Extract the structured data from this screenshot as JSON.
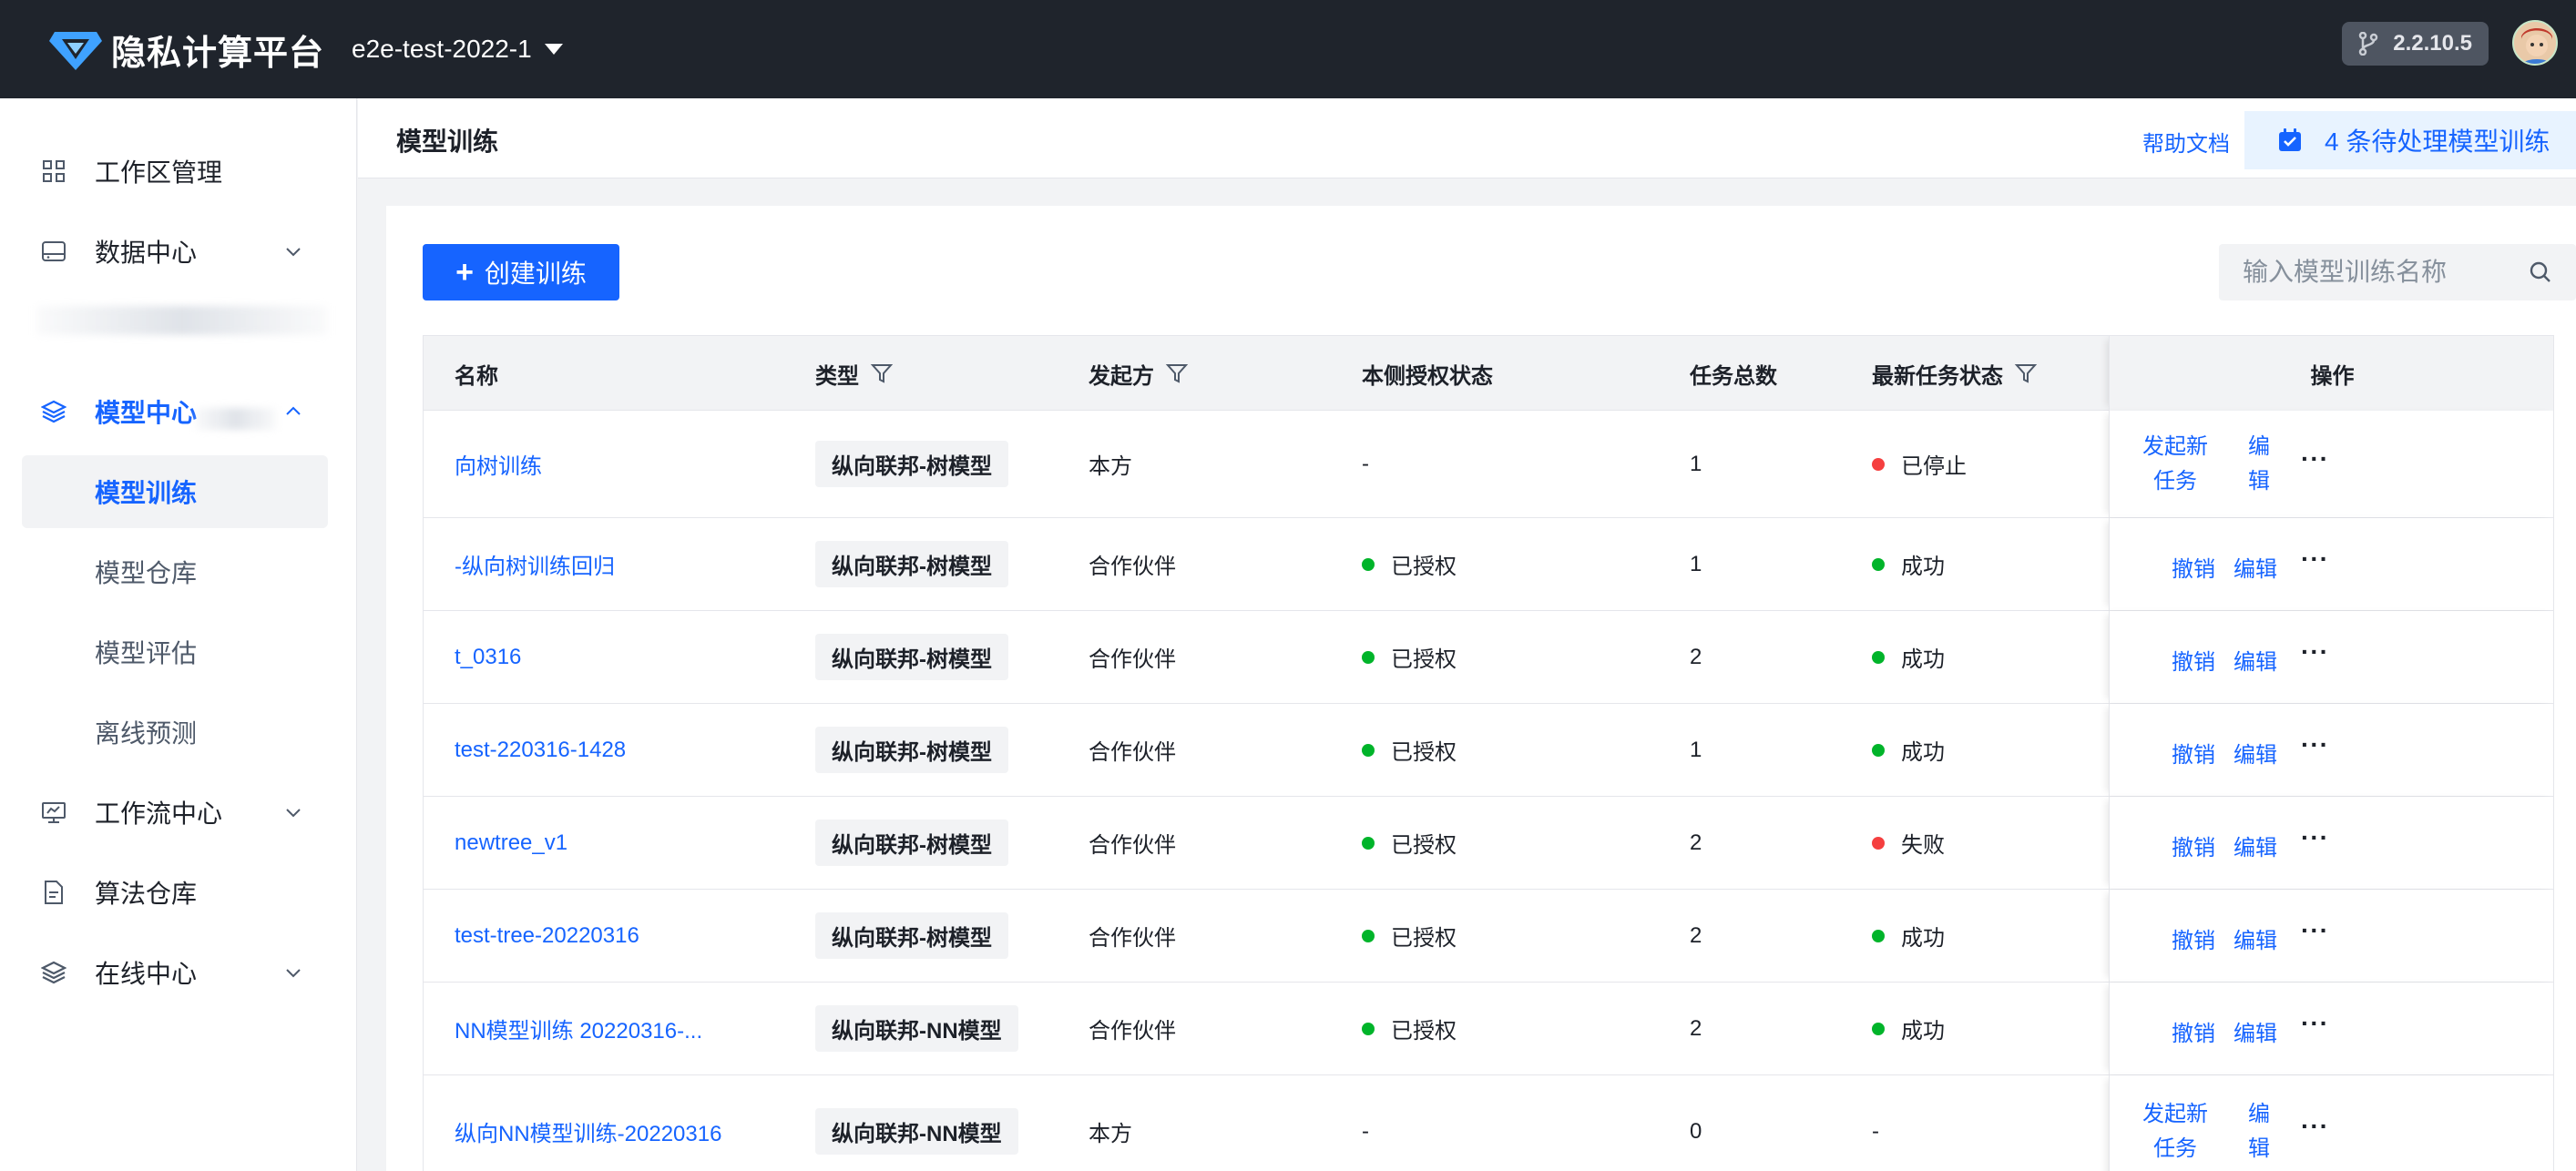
{
  "header": {
    "logo_text": "隐私计算平台",
    "project": "e2e-test-2022-1",
    "version": "2.2.10.5"
  },
  "sidebar": {
    "items": [
      {
        "label": "工作区管理",
        "icon": "grid-icon"
      },
      {
        "label": "数据中心",
        "icon": "hard-drive-icon"
      },
      {
        "label": "模型中心",
        "icon": "layers-icon"
      },
      {
        "label": "工作流中心",
        "icon": "monitor-icon"
      },
      {
        "label": "算法仓库",
        "icon": "file-icon"
      },
      {
        "label": "在线中心",
        "icon": "layers-icon"
      }
    ],
    "model_sub": [
      "模型训练",
      "模型仓库",
      "模型评估",
      "离线预测"
    ]
  },
  "page": {
    "title": "模型训练",
    "help": "帮助文档",
    "pending": "4 条待处理模型训练",
    "create_label": "创建训练",
    "search_placeholder": "输入模型训练名称"
  },
  "table": {
    "headers": [
      "名称",
      "类型",
      "发起方",
      "本侧授权状态",
      "任务总数",
      "最新任务状态",
      "操作"
    ],
    "rows": [
      {
        "name": "向树训练",
        "type": "纵向联邦-树模型",
        "initiator": "本方",
        "auth": "-",
        "auth_dot": "",
        "count": "1",
        "status": "已停止",
        "status_dot": "red",
        "ops": [
          "发起新任务",
          "编辑"
        ]
      },
      {
        "name": "-纵向树训练回归",
        "type": "纵向联邦-树模型",
        "initiator": "合作伙伴",
        "auth": "已授权",
        "auth_dot": "green",
        "count": "1",
        "status": "成功",
        "status_dot": "green",
        "ops": [
          "撤销",
          "编辑"
        ]
      },
      {
        "name": "t_0316",
        "type": "纵向联邦-树模型",
        "initiator": "合作伙伴",
        "auth": "已授权",
        "auth_dot": "green",
        "count": "2",
        "status": "成功",
        "status_dot": "green",
        "ops": [
          "撤销",
          "编辑"
        ]
      },
      {
        "name": "test-220316-1428",
        "type": "纵向联邦-树模型",
        "initiator": "合作伙伴",
        "auth": "已授权",
        "auth_dot": "green",
        "count": "1",
        "status": "成功",
        "status_dot": "green",
        "ops": [
          "撤销",
          "编辑"
        ]
      },
      {
        "name": "newtree_v1",
        "type": "纵向联邦-树模型",
        "initiator": "合作伙伴",
        "auth": "已授权",
        "auth_dot": "green",
        "count": "2",
        "status": "失败",
        "status_dot": "red",
        "ops": [
          "撤销",
          "编辑"
        ]
      },
      {
        "name": "test-tree-20220316",
        "type": "纵向联邦-树模型",
        "initiator": "合作伙伴",
        "auth": "已授权",
        "auth_dot": "green",
        "count": "2",
        "status": "成功",
        "status_dot": "green",
        "ops": [
          "撤销",
          "编辑"
        ]
      },
      {
        "name": "NN模型训练 20220316-...",
        "type": "纵向联邦-NN模型",
        "initiator": "合作伙伴",
        "auth": "已授权",
        "auth_dot": "green",
        "count": "2",
        "status": "成功",
        "status_dot": "green",
        "ops": [
          "撤销",
          "编辑"
        ]
      },
      {
        "name": "纵向NN模型训练-20220316",
        "type": "纵向联邦-NN模型",
        "initiator": "本方",
        "auth": "-",
        "auth_dot": "",
        "count": "0",
        "status": "-",
        "status_dot": "",
        "ops": [
          "发起新任务",
          "编辑"
        ]
      }
    ],
    "more": "···"
  },
  "colors": {
    "primary": "#1664ff",
    "header_bg": "#1f242c",
    "success": "#00b42a",
    "danger": "#f53f3f"
  }
}
